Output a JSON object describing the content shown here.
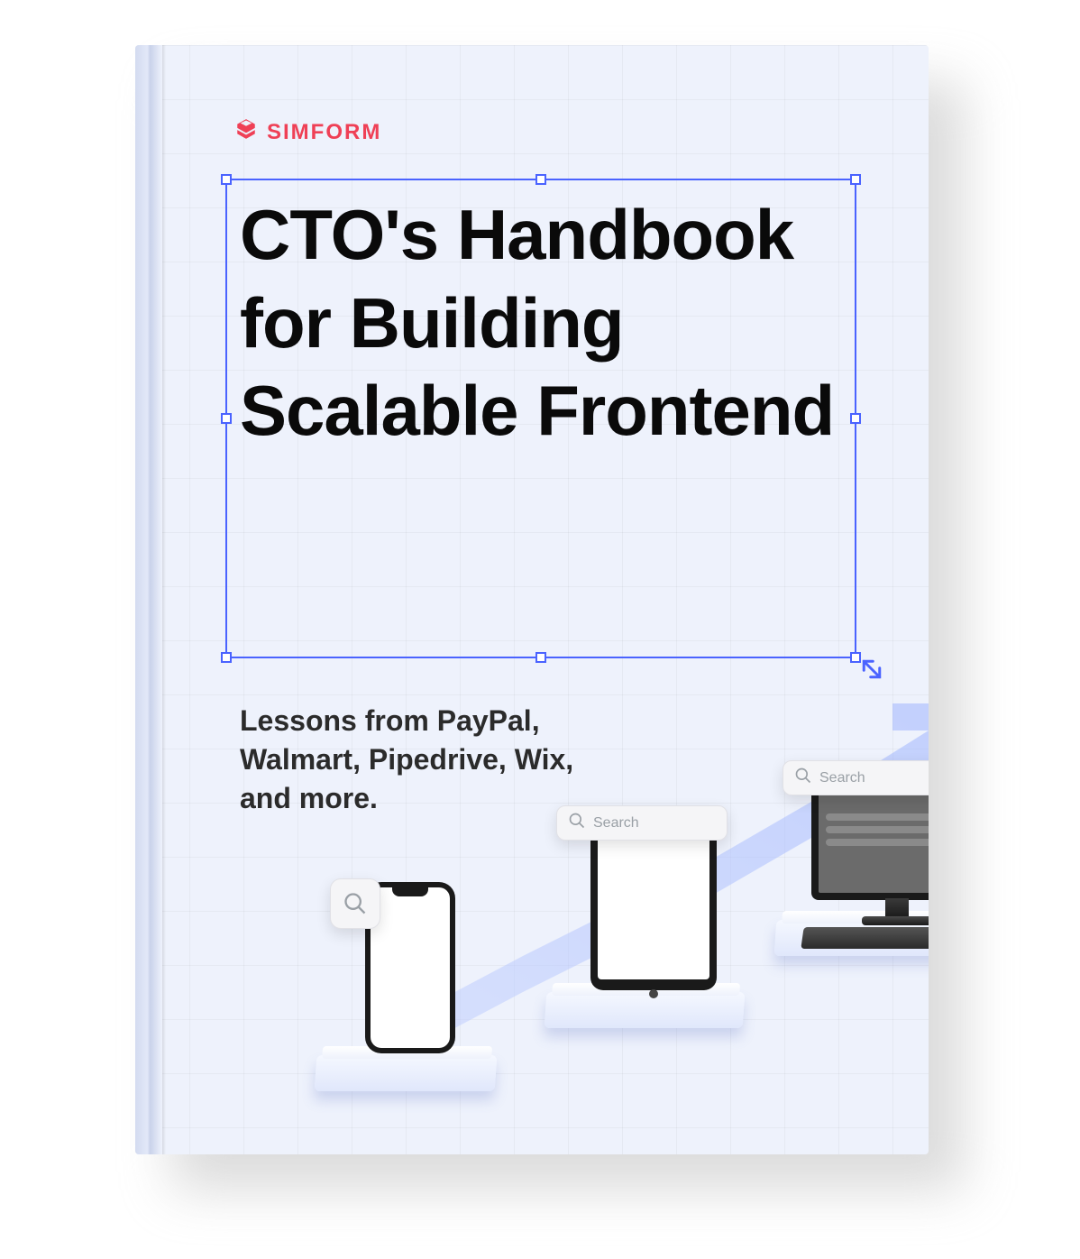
{
  "brand": {
    "name": "SIMFORM",
    "color": "#ef4056"
  },
  "headline": "CTO's Handbook for Building Scalable Frontend",
  "subhead": "Lessons from PayPal, Walmart, Pipedrive, Wix, and more.",
  "search_label": "Search",
  "selection_accent": "#4a63ff",
  "page_bg": "#eef2fc"
}
